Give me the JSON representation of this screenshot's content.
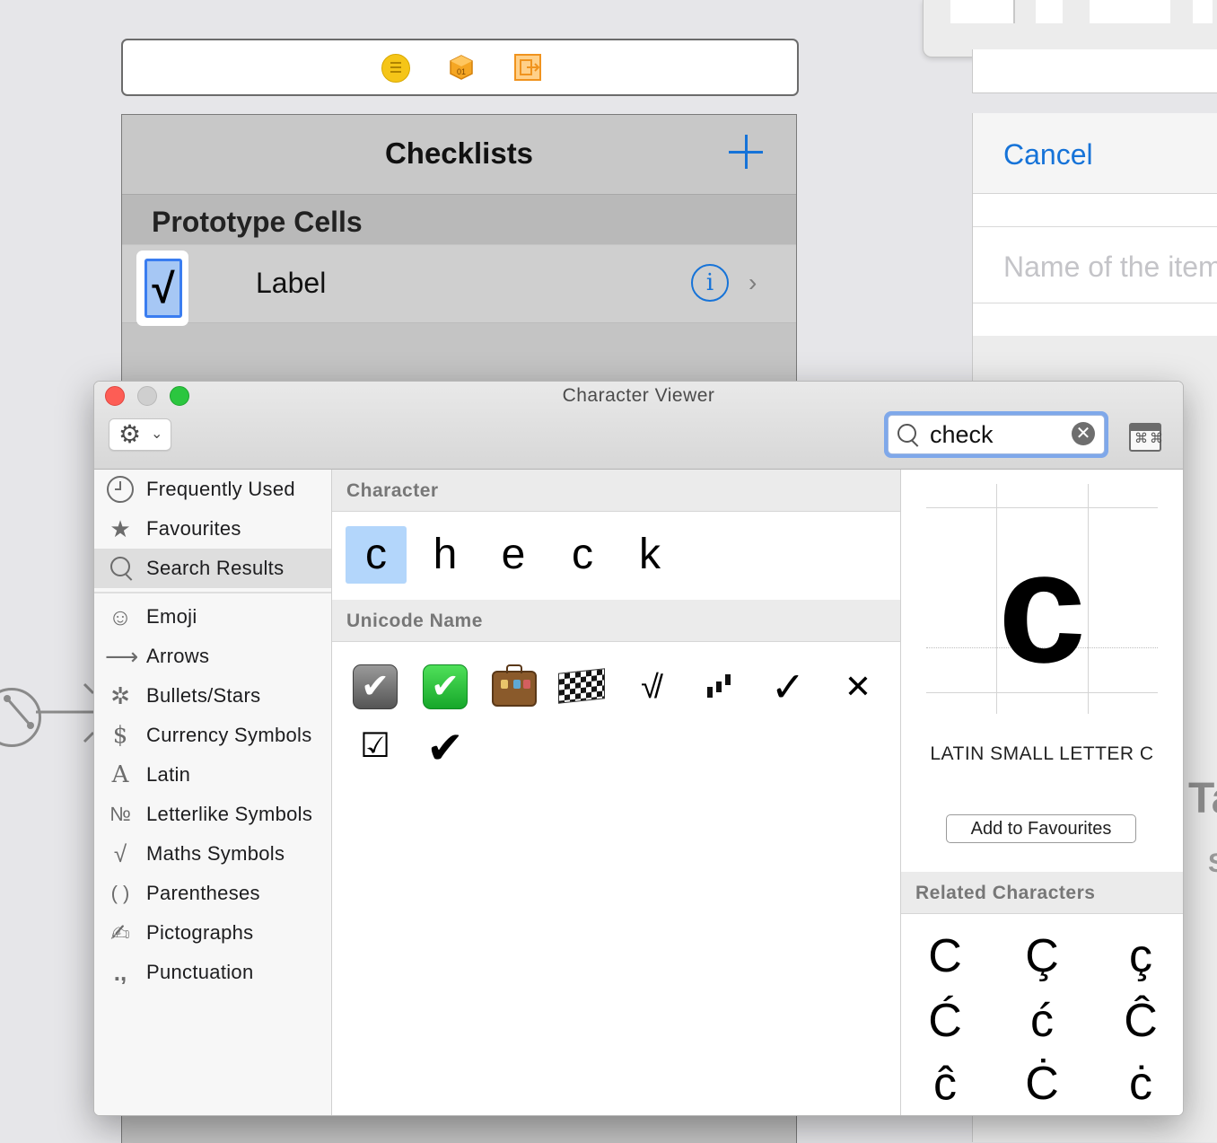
{
  "storyboard": {
    "nav_title": "Checklists",
    "add_button": "+",
    "section_header": "Prototype Cells",
    "cell_image_glyph": "√",
    "cell_label": "Label",
    "info_glyph": "i",
    "chevron": "›",
    "right_scene": {
      "cancel_label": "Cancel",
      "field_placeholder": "Name of the item",
      "partial_text_1": "Ta",
      "partial_text_2": "S"
    },
    "dock_icons": [
      "view-controller-icon",
      "first-responder-icon",
      "exit-icon"
    ]
  },
  "character_viewer": {
    "title": "Character Viewer",
    "search": {
      "value": "check",
      "clear_glyph": "✕"
    },
    "sidebar": {
      "items": [
        {
          "icon": "clock-icon",
          "glyph": "",
          "label": "Frequently Used"
        },
        {
          "icon": "star-icon",
          "glyph": "★",
          "label": "Favourites"
        },
        {
          "icon": "search-icon",
          "glyph": "",
          "label": "Search Results",
          "selected": true
        },
        {
          "icon": "smiley-icon",
          "glyph": "☺",
          "label": "Emoji"
        },
        {
          "icon": "arrow-icon",
          "glyph": "⟶",
          "label": "Arrows"
        },
        {
          "icon": "asterisk-icon",
          "glyph": "✲",
          "label": "Bullets/Stars"
        },
        {
          "icon": "dollar-icon",
          "glyph": "$",
          "label": "Currency Symbols"
        },
        {
          "icon": "latin-icon",
          "glyph": "A",
          "label": "Latin"
        },
        {
          "icon": "numero-icon",
          "glyph": "№",
          "label": "Letterlike Symbols"
        },
        {
          "icon": "sqrt-icon",
          "glyph": "√",
          "label": "Maths Symbols"
        },
        {
          "icon": "parentheses-icon",
          "glyph": "( )",
          "label": "Parentheses"
        },
        {
          "icon": "writing-hand-icon",
          "glyph": "✍",
          "label": "Pictographs"
        },
        {
          "icon": "punctuation-icon",
          "glyph": ".,",
          "label": "Punctuation"
        }
      ]
    },
    "character_section": {
      "header": "Character",
      "chars": [
        "c",
        "h",
        "e",
        "c",
        "k"
      ]
    },
    "unicode_section": {
      "header": "Unicode Name",
      "chars": [
        {
          "name": "heavy-check-mark-grey-emoji",
          "glyph": "✔"
        },
        {
          "name": "white-heavy-check-mark-emoji",
          "glyph": "✔"
        },
        {
          "name": "luggage-emoji",
          "glyph": ""
        },
        {
          "name": "chequered-flag-emoji",
          "glyph": ""
        },
        {
          "name": "root-with-check-glyph",
          "glyph": "√̸"
        },
        {
          "name": "checker-board-glyph",
          "glyph": "▖▘"
        },
        {
          "name": "check-mark-glyph",
          "glyph": "✓"
        },
        {
          "name": "multiplication-x-glyph",
          "glyph": "✕"
        },
        {
          "name": "ballot-box-with-check-glyph",
          "glyph": "☑"
        },
        {
          "name": "heavy-check-mark-glyph",
          "glyph": "✔"
        }
      ]
    },
    "inspector": {
      "glyph": "c",
      "name": "LATIN SMALL LETTER C",
      "add_favourites": "Add to Favourites",
      "related_header": "Related Characters",
      "related": [
        "C",
        "Ç",
        "ç",
        "Ć",
        "ć",
        "Ĉ",
        "ĉ",
        "Ċ",
        "ċ"
      ]
    }
  }
}
